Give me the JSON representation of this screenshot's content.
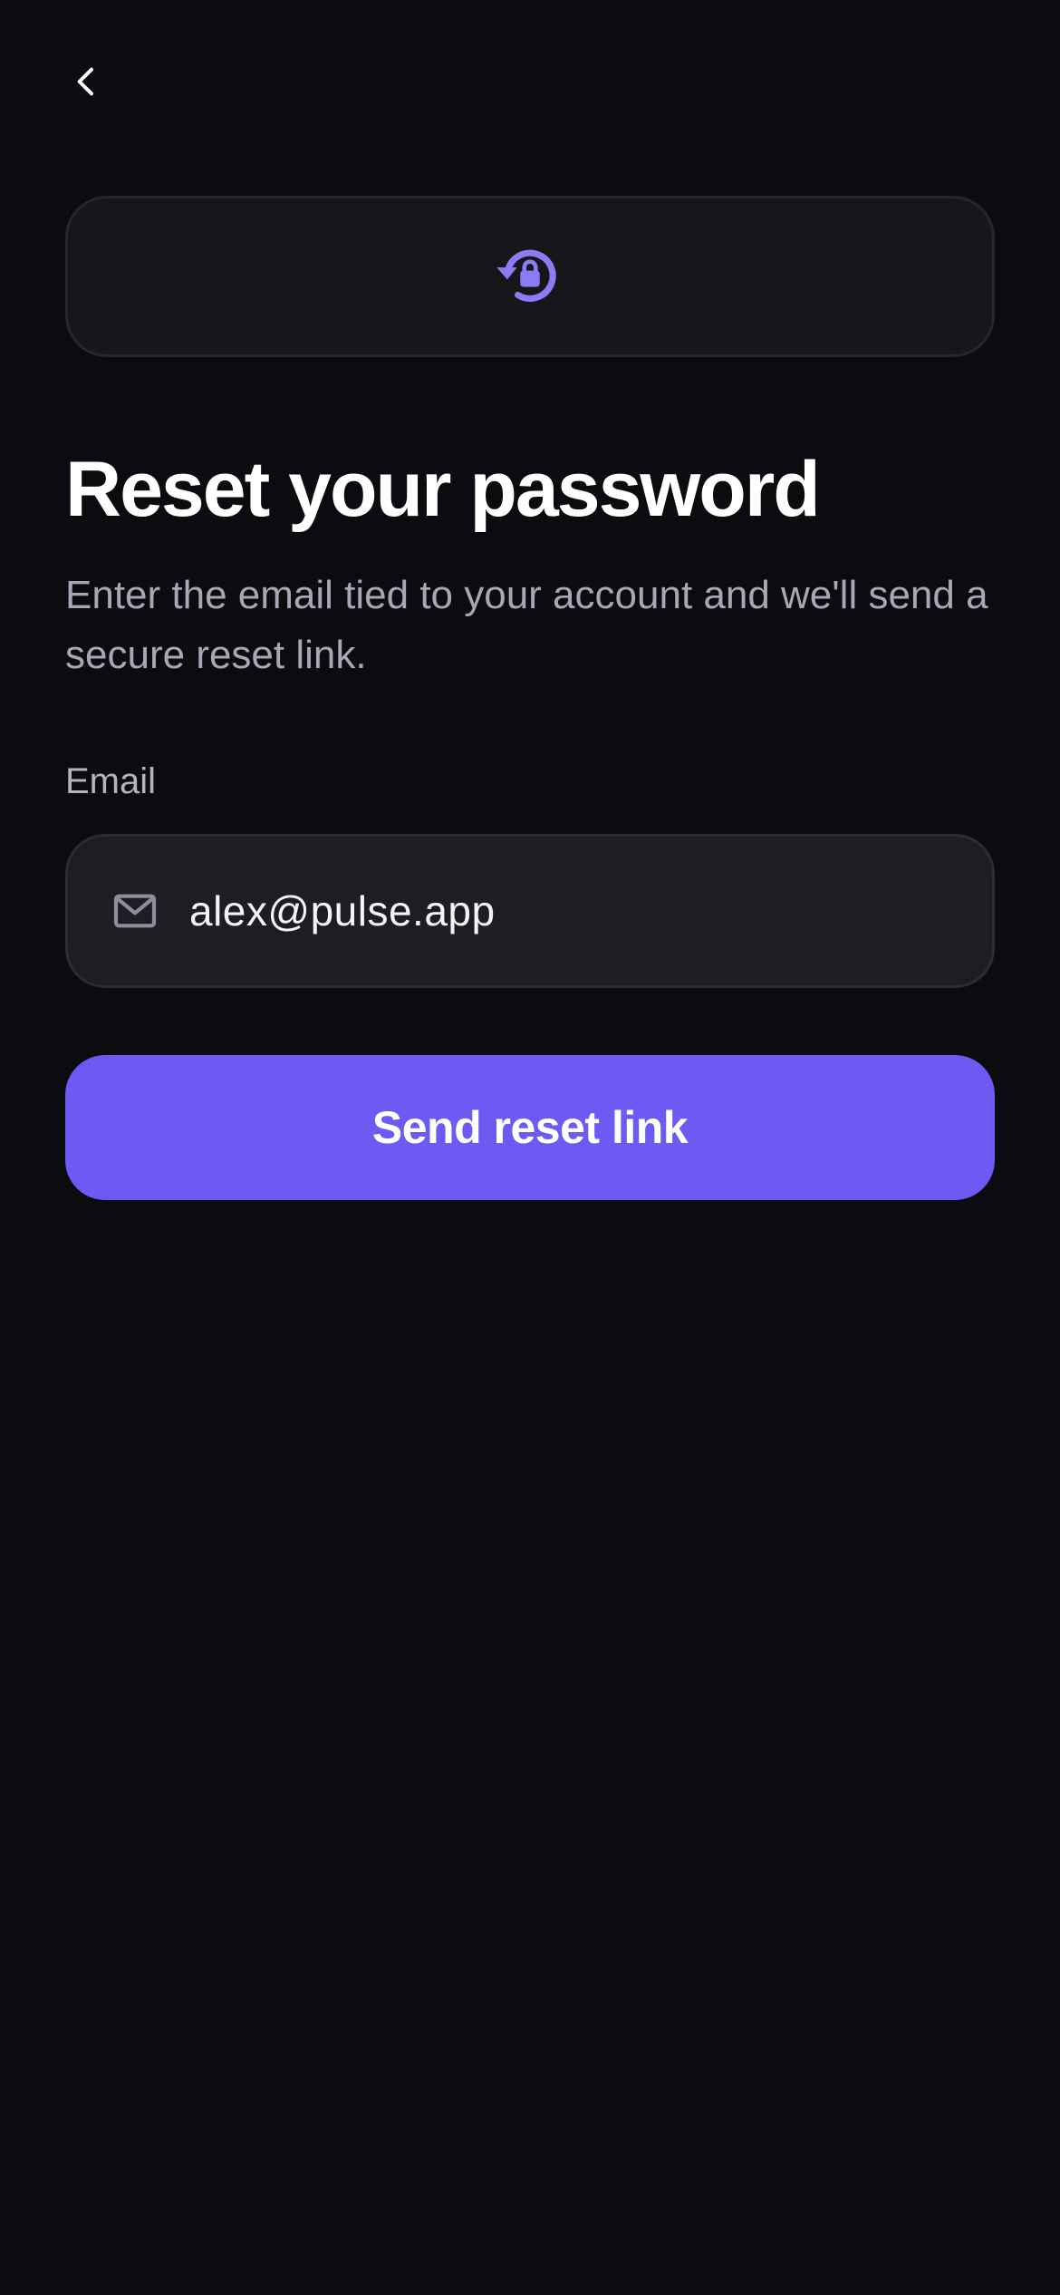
{
  "nav": {
    "back_icon": "chevron-left-icon"
  },
  "hero": {
    "icon": "lock-reset-icon",
    "accent_color": "#8B7CF6"
  },
  "header": {
    "title": "Reset your password",
    "subtitle": "Enter the email tied to your account and we'll send a secure reset link."
  },
  "form": {
    "email_label": "Email",
    "email_icon": "mail-icon",
    "email_value": "alex@pulse.app",
    "submit_label": "Send reset link",
    "submit_color": "#6C5AF2"
  },
  "colors": {
    "background": "#0B0B10",
    "card": "#16161B",
    "input": "#1D1D24"
  }
}
